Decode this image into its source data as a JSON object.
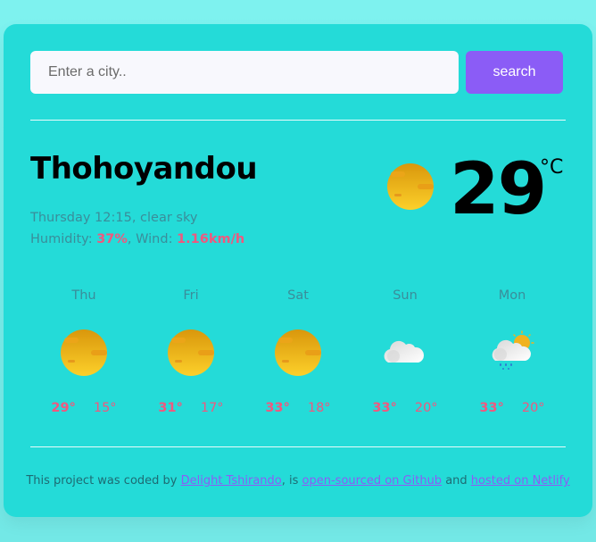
{
  "search": {
    "placeholder": "Enter a city..",
    "value": "",
    "button_label": "search"
  },
  "current": {
    "city": "Thohoyandou",
    "datetime_desc": "Thursday 12:15, clear sky",
    "humidity_label": "Humidity: ",
    "humidity_value": "37%",
    "wind_label": ", Wind: ",
    "wind_value": "1.16km/h",
    "temperature": "29",
    "unit": "°C",
    "icon": "clear-sky-sun-icon"
  },
  "forecast": [
    {
      "day": "Thu",
      "max": "29°",
      "min": "15°",
      "icon": "sun"
    },
    {
      "day": "Fri",
      "max": "31°",
      "min": "17°",
      "icon": "sun"
    },
    {
      "day": "Sat",
      "max": "33°",
      "min": "18°",
      "icon": "sun"
    },
    {
      "day": "Sun",
      "max": "33°",
      "min": "20°",
      "icon": "cloud"
    },
    {
      "day": "Mon",
      "max": "33°",
      "min": "20°",
      "icon": "rain-sun-cloud"
    }
  ],
  "footer": {
    "prefix": "This project was coded by ",
    "author_link": "Delight Tshirando",
    "middle1": ", is ",
    "github_link": "open-sourced on Github",
    "middle2": " and ",
    "netlify_link": "hosted on Netlify"
  },
  "colors": {
    "background": "#7ef2ef",
    "card": "#24dbd8",
    "accent": "#8b5cf6",
    "highlight": "#f0587e",
    "muted_text": "#3a8d9a"
  }
}
